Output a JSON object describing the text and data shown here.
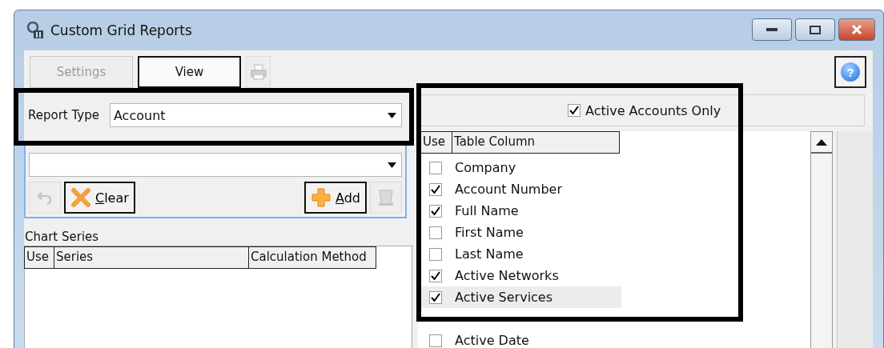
{
  "window": {
    "title": "Custom Grid Reports"
  },
  "tabs": [
    {
      "label": "Settings",
      "selected": false,
      "disabled": true
    },
    {
      "label": "View",
      "selected": true,
      "disabled": false
    }
  ],
  "print_button": {
    "disabled": true
  },
  "help_button": {
    "glyph": "?"
  },
  "report_type": {
    "label": "Report Type",
    "value": "Account"
  },
  "custom_reports": {
    "undo_button": {
      "disabled": true
    },
    "clear_button": {
      "label": "Clear"
    },
    "add_button": {
      "label": "Add"
    },
    "delete_button": {
      "disabled": true
    }
  },
  "chart_series": {
    "label": "Chart Series",
    "columns": [
      "Use",
      "Series",
      "Calculation Method"
    ]
  },
  "active_accounts_only": {
    "label": "Active Accounts Only",
    "checked": true
  },
  "table_columns": {
    "columns": [
      "Use",
      "Table Column"
    ],
    "rows": [
      {
        "name": "Company",
        "checked": false,
        "selected": false
      },
      {
        "name": "Account Number",
        "checked": true,
        "selected": false
      },
      {
        "name": "Full Name",
        "checked": true,
        "selected": false
      },
      {
        "name": "First Name",
        "checked": false,
        "selected": false
      },
      {
        "name": "Last Name",
        "checked": false,
        "selected": false
      },
      {
        "name": "Active Networks",
        "checked": true,
        "selected": false
      },
      {
        "name": "Active Services",
        "checked": true,
        "selected": true
      },
      {
        "name": "Active Date",
        "checked": false,
        "selected": false
      }
    ]
  }
}
